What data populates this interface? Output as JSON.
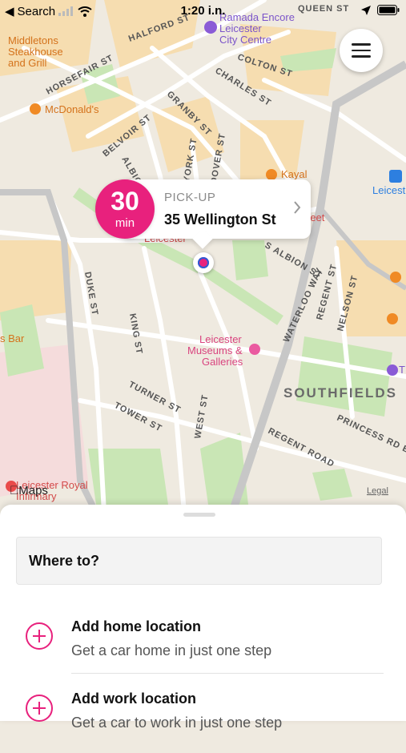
{
  "status_bar": {
    "back_label": "Search",
    "time": "1:20 i.n."
  },
  "map": {
    "poi": {
      "middletons": "Middletons Steakhouse and Grill",
      "ramada": "Ramada Encore Leicester City Centre",
      "mcdonalds": "McDonald's",
      "kayal": "Kayal",
      "leicester_partial": "Leicest",
      "leicester_label": "Leicester",
      "museums": "Leicester Museums & Galleries",
      "bar_partial": "s Bar",
      "royal": "Leicester Royal Infirmary",
      "street_partial": "reet",
      "t_partial": "T"
    },
    "streets": [
      "HALFORD ST",
      "QUEEN ST",
      "HORSEFAIR ST",
      "COLTON ST",
      "CHARLES ST",
      "GRANBY ST",
      "BELVOIR ST",
      "ALBION ST",
      "YORK ST",
      "DOVER ST",
      "S ALBION ST",
      "DUKE ST",
      "KING ST",
      "WATERLOO WAY",
      "REGENT ST",
      "NELSON ST",
      "TURNER ST",
      "TOWER ST",
      "WEST ST",
      "REGENT ROAD",
      "PRINCESS RD E"
    ],
    "area_label": "SOUTHFIELDS",
    "attribution": "Maps",
    "legal": "Legal",
    "colors": {
      "accent": "#e8217d"
    }
  },
  "pickup": {
    "eta_number": "30",
    "eta_unit": "min",
    "label": "PICK-UP",
    "address": "35 Wellington St"
  },
  "sheet": {
    "search_placeholder": "Where to?",
    "rows": [
      {
        "title": "Add home location",
        "subtitle": "Get a car home in just one step"
      },
      {
        "title": "Add work location",
        "subtitle": "Get a car to work in just one step"
      }
    ]
  }
}
